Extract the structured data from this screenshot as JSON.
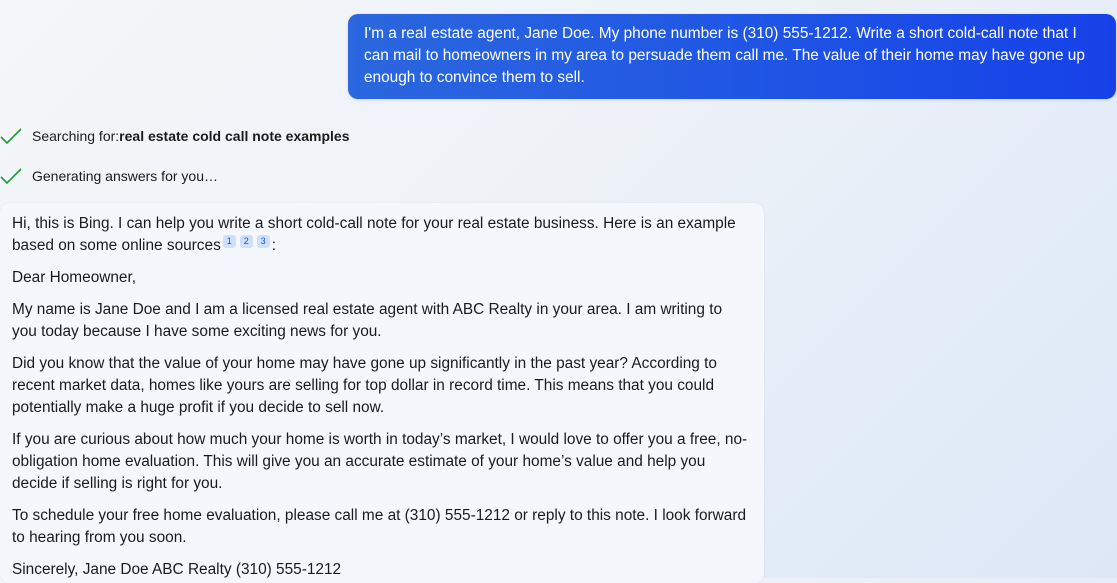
{
  "user_message": "I'm a real estate agent, Jane Doe. My phone number is (310) 555-1212. Write a short cold-call note that I can mail to homeowners in my area to persuade them call me. The value of their home may have gone up enough to convince them to sell.",
  "status": {
    "searching_prefix": "Searching for: ",
    "searching_query": "real estate cold call note examples",
    "generating": "Generating answers for you…"
  },
  "response": {
    "intro": "Hi, this is Bing. I can help you write a short cold-call note for your real estate business. Here is an example based on some online sources",
    "citations": [
      "1",
      "2",
      "3"
    ],
    "intro_suffix": ":",
    "greeting": "Dear Homeowner,",
    "paragraph_1": "My name is Jane Doe and I am a licensed real estate agent with ABC Realty in your area. I am writing to you today because I have some exciting news for you.",
    "paragraph_2": "Did you know that the value of your home may have gone up significantly in the past year? According to recent market data, homes like yours are selling for top dollar in record time. This means that you could potentially make a huge profit if you decide to sell now.",
    "paragraph_3": "If you are curious about how much your home is worth in today’s market, I would love to offer you a free, no-obligation home evaluation. This will give you an accurate estimate of your home’s value and help you decide if selling is right for you.",
    "paragraph_4": "To schedule your free home evaluation, please call me at (310) 555-1212 or reply to this note. I look forward to hearing from you soon.",
    "signature": "Sincerely, Jane Doe ABC Realty (310) 555-1212"
  },
  "colors": {
    "user_bubble": "#1f55e4",
    "check": "#1f9d3a",
    "citation_bg": "#cfe0fb"
  }
}
